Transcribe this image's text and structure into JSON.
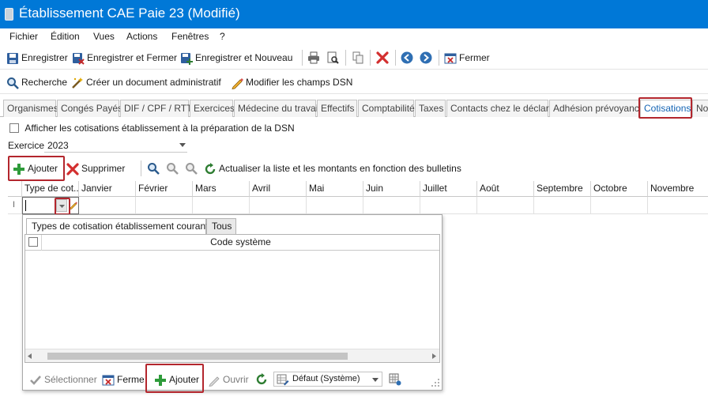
{
  "window": {
    "title": "Établissement CAE Paie 23 (Modifié)"
  },
  "menu": [
    "Fichier",
    "Édition",
    "Vues",
    "Actions",
    "Fenêtres",
    "?"
  ],
  "toolbar1": {
    "save": "Enregistrer",
    "save_close": "Enregistrer et Fermer",
    "save_new": "Enregistrer et Nouveau",
    "close": "Fermer"
  },
  "toolbar2": {
    "search": "Recherche",
    "create_doc": "Créer un document administratif",
    "edit_dsn": "Modifier les champs DSN"
  },
  "tabs": [
    "Organismes",
    "Congés Payés",
    "DIF / CPF / RTT",
    "Exercices",
    "Médecine du travail",
    "Effectifs",
    "Comptabilité",
    "Taxes",
    "Contacts chez le déclaré",
    "Adhésion prévoyance",
    "Cotisations",
    "Not"
  ],
  "active_tab": "Cotisations",
  "options": {
    "show_dsn_label": "Afficher les cotisations établissement à la préparation de la DSN",
    "exercice_label": "Exercice",
    "exercice_value": "2023"
  },
  "grid_toolbar": {
    "add": "Ajouter",
    "delete": "Supprimer",
    "refresh": "Actualiser la liste et les montants en fonction des bulletins"
  },
  "grid": {
    "columns": [
      "Type de cot...",
      "Janvier",
      "Février",
      "Mars",
      "Avril",
      "Mai",
      "Juin",
      "Juillet",
      "Août",
      "Septembre",
      "Octobre",
      "Novembre"
    ],
    "row_marker": "I"
  },
  "popup": {
    "tab_current": "Types de cotisation établissement courants",
    "tab_all": "Tous",
    "column": "Code système",
    "select": "Sélectionner",
    "close": "Fermer",
    "add": "Ajouter",
    "open": "Ouvrir",
    "default_view": "Défaut (Système)"
  },
  "colors": {
    "title_bar": "#0078d7",
    "highlight": "#b3262d",
    "active_tab_text": "#1464b4"
  }
}
